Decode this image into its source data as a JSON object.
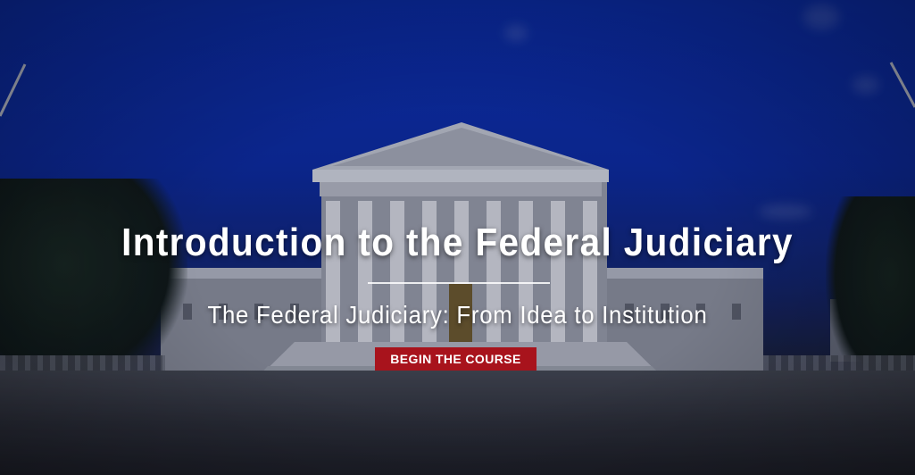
{
  "hero": {
    "title": "Introduction to the Federal Judiciary",
    "subtitle": "The Federal Judiciary: From Idea to Institution",
    "cta_label": "BEGIN THE COURSE"
  },
  "colors": {
    "cta_background": "#a8131c",
    "sky": "#0b2a9f",
    "text": "#ffffff"
  }
}
